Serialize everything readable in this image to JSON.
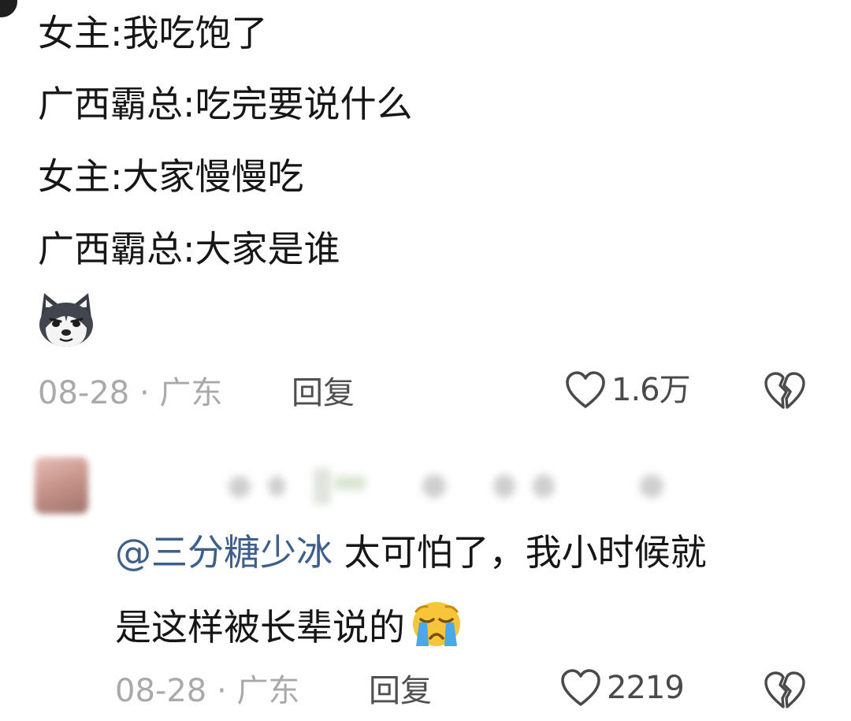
{
  "comment1": {
    "lines": [
      "女主:我吃饱了",
      "广西霸总:吃完要说什么",
      "女主:大家慢慢吃",
      "广西霸总:大家是谁"
    ],
    "sticker_icon": "husky-dog-emoji",
    "date": "08-28",
    "separator": "·",
    "location": "广东",
    "reply_label": "回复",
    "like_count": "1.6万",
    "like_icon": "heart-outline-icon",
    "dislike_icon": "broken-heart-icon"
  },
  "comment2": {
    "mention": "@三分糖少冰",
    "text_line1": "太可怕了，我小时候就",
    "text_line2": "是这样被长辈说的",
    "emoji_icon": "crying-face-emoji",
    "date": "08-28",
    "separator": "·",
    "location": "广东",
    "reply_label": "回复",
    "like_count": "2219",
    "like_icon": "heart-outline-icon",
    "dislike_icon": "broken-heart-icon"
  },
  "colors": {
    "mention": "#3d5f8c",
    "meta_gray": "#a9a9a9",
    "text": "#161616"
  }
}
